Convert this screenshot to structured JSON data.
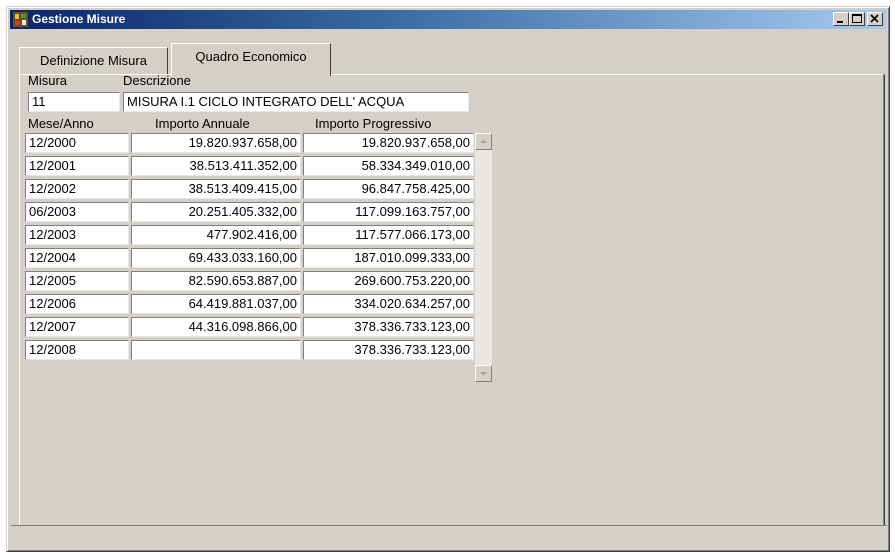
{
  "window": {
    "title": "Gestione Misure",
    "icon": "app-icon"
  },
  "tabs": [
    {
      "label": "Definizione Misura",
      "active": false
    },
    {
      "label": "Quadro Economico",
      "active": true
    }
  ],
  "header": {
    "misura_label": "Misura",
    "descrizione_label": "Descrizione",
    "misura_value": "11",
    "descrizione_value": "MISURA I.1 CICLO INTEGRATO DELL' ACQUA"
  },
  "table": {
    "columns": [
      "Mese/Anno",
      "Importo Annuale",
      "Importo Progressivo"
    ],
    "rows": [
      {
        "mese": "12/2000",
        "annuale": "19.820.937.658,00",
        "progressivo": "19.820.937.658,00"
      },
      {
        "mese": "12/2001",
        "annuale": "38.513.411.352,00",
        "progressivo": "58.334.349.010,00"
      },
      {
        "mese": "12/2002",
        "annuale": "38.513.409.415,00",
        "progressivo": "96.847.758.425,00"
      },
      {
        "mese": "06/2003",
        "annuale": "20.251.405.332,00",
        "progressivo": "117.099.163.757,00"
      },
      {
        "mese": "12/2003",
        "annuale": "477.902.416,00",
        "progressivo": "117.577.066.173,00"
      },
      {
        "mese": "12/2004",
        "annuale": "69.433.033.160,00",
        "progressivo": "187.010.099.333,00"
      },
      {
        "mese": "12/2005",
        "annuale": "82.590.653.887,00",
        "progressivo": "269.600.753.220,00"
      },
      {
        "mese": "12/2006",
        "annuale": "64.419.881.037,00",
        "progressivo": "334.020.634.257,00"
      },
      {
        "mese": "12/2007",
        "annuale": "44.316.098.866,00",
        "progressivo": "378.336.733.123,00"
      },
      {
        "mese": "12/2008",
        "annuale": "",
        "progressivo": "378.336.733.123,00"
      }
    ]
  },
  "colors": {
    "titlebar_start": "#0a246a",
    "titlebar_end": "#a6caf0",
    "face": "#d4d0c8"
  }
}
